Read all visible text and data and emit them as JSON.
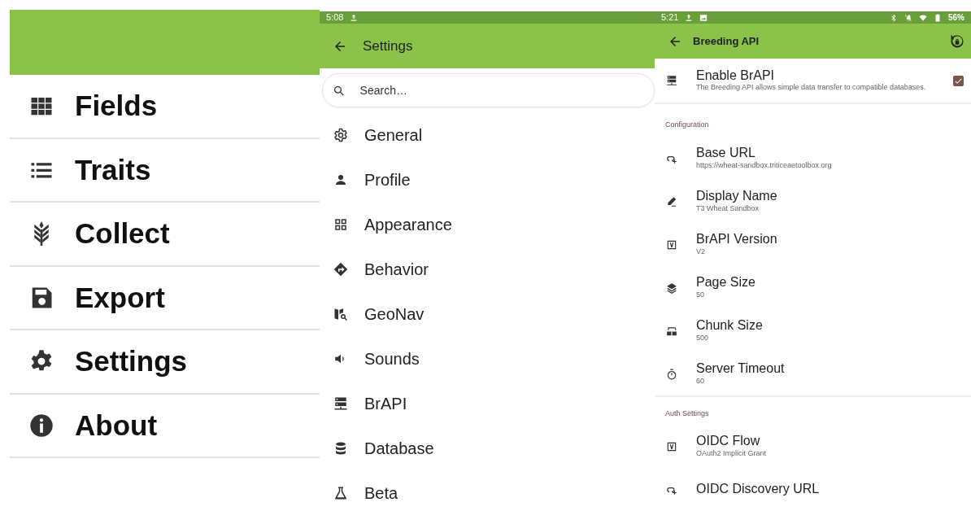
{
  "home": {
    "items": [
      {
        "label": "Fields"
      },
      {
        "label": "Traits"
      },
      {
        "label": "Collect"
      },
      {
        "label": "Export"
      },
      {
        "label": "Settings"
      },
      {
        "label": "About"
      }
    ]
  },
  "settings": {
    "status_bar": {
      "time": "5:08"
    },
    "title": "Settings",
    "search": {
      "placeholder": "Search…"
    },
    "items": [
      {
        "label": "General"
      },
      {
        "label": "Profile"
      },
      {
        "label": "Appearance"
      },
      {
        "label": "Behavior"
      },
      {
        "label": "GeoNav"
      },
      {
        "label": "Sounds"
      },
      {
        "label": "BrAPI"
      },
      {
        "label": "Database"
      },
      {
        "label": "Beta"
      }
    ]
  },
  "brapi": {
    "status_bar": {
      "time": "5:21",
      "battery": "56%"
    },
    "title": "Breeding API",
    "enable": {
      "title": "Enable BrAPI",
      "summary": "The Breeding API allows simple data transfer to compatible databases.",
      "checked": true
    },
    "groups": [
      {
        "header": "Configuration",
        "items": [
          {
            "title": "Base URL",
            "summary": "https://wheat-sandbox.triticeaetoolbox.org"
          },
          {
            "title": "Display Name",
            "summary": "T3 Wheat Sandbox"
          },
          {
            "title": "BrAPI Version",
            "summary": "V2"
          },
          {
            "title": "Page Size",
            "summary": "50"
          },
          {
            "title": "Chunk Size",
            "summary": "500"
          },
          {
            "title": "Server Timeout",
            "summary": "60"
          }
        ]
      },
      {
        "header": "Auth Settings",
        "items": [
          {
            "title": "OIDC Flow",
            "summary": "OAuth2 Implicit Grant"
          },
          {
            "title": "OIDC Discovery URL"
          }
        ]
      }
    ]
  }
}
